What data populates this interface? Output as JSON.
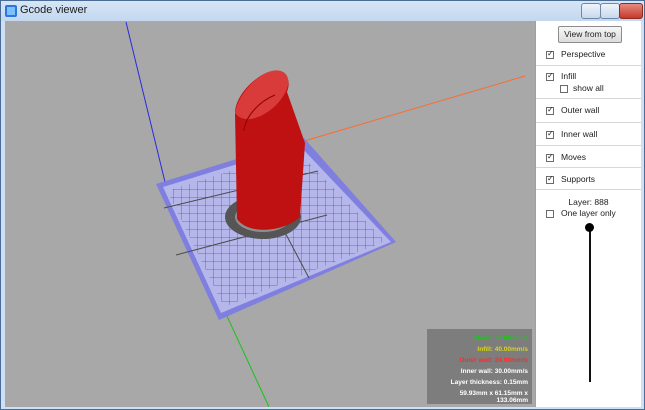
{
  "window": {
    "title": "Gcode viewer"
  },
  "colors": {
    "move": "#19c819",
    "infill": "#d6d61a",
    "outer_wall": "#ff2b2b",
    "inner_wall": "#ffffff",
    "model": "#bf1111",
    "bed": "#7f7fe0",
    "background": "#a8a8a8"
  },
  "sidebar": {
    "view_from_top": "View from top",
    "perspective": {
      "label": "Perspective",
      "checked": true
    },
    "infill": {
      "label": "Infill",
      "checked": true
    },
    "show_all": {
      "label": "show all",
      "checked": false
    },
    "outer_wall": {
      "label": "Outer wall",
      "checked": true
    },
    "inner_wall": {
      "label": "Inner wall",
      "checked": true
    },
    "moves": {
      "label": "Moves",
      "checked": true
    },
    "supports": {
      "label": "Supports",
      "checked": true
    },
    "layer": {
      "label": "Layer: 888"
    },
    "one_layer_only": {
      "label": "One layer only",
      "checked": false
    }
  },
  "overlay": {
    "move_speed": "Move: 30.00mm/s",
    "infill_speed": "Infill: 40.00mm/s",
    "outer_wall_speed": "Outer wall: 24.00mm/s",
    "inner_wall_speed": "Inner wall: 30.00mm/s",
    "layer_thickness": "Layer thickness: 0.15mm",
    "dimensions": "59.93mm x 61.15mm x 133.06mm"
  }
}
